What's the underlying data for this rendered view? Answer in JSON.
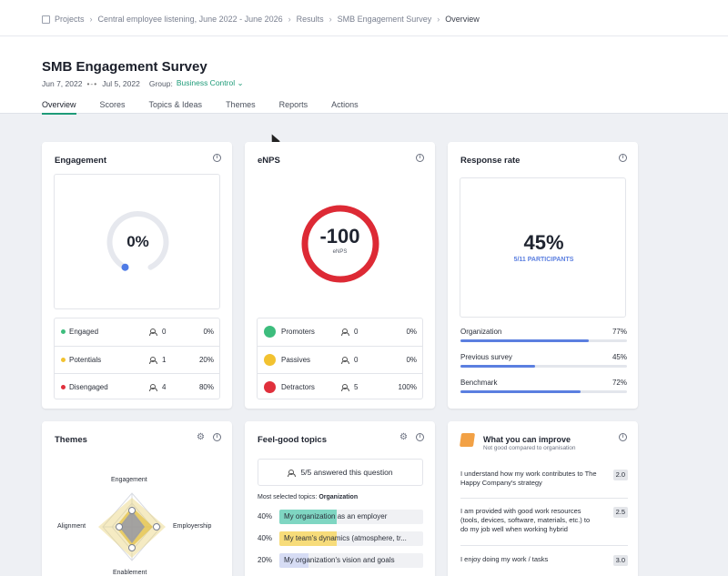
{
  "breadcrumb": [
    "Projects",
    "Central employee listening, June 2022 - June 2026",
    "Results",
    "SMB Engagement Survey",
    "Overview"
  ],
  "header": {
    "title": "SMB Engagement Survey",
    "date_start": "Jun 7, 2022",
    "date_end": "Jul 5, 2022",
    "group_label": "Group:",
    "group_value": "Business Control"
  },
  "tabs": [
    "Overview",
    "Scores",
    "Topics & Ideas",
    "Themes",
    "Reports",
    "Actions"
  ],
  "engagement": {
    "title": "Engagement",
    "value": "0%",
    "gauge_fraction": 0.0,
    "rows": [
      {
        "label": "Engaged",
        "count": "0",
        "pct": "0%",
        "color": "#3dbd7d"
      },
      {
        "label": "Potentials",
        "count": "1",
        "pct": "20%",
        "color": "#f2c230"
      },
      {
        "label": "Disengaged",
        "count": "4",
        "pct": "80%",
        "color": "#e0303c"
      }
    ]
  },
  "enps": {
    "title": "eNPS",
    "value": "-100",
    "sub": "eNPS",
    "rows": [
      {
        "label": "Promoters",
        "count": "0",
        "pct": "0%",
        "color": "#3dbd7d"
      },
      {
        "label": "Passives",
        "count": "0",
        "pct": "0%",
        "color": "#f2c230"
      },
      {
        "label": "Detractors",
        "count": "5",
        "pct": "100%",
        "color": "#e0303c"
      }
    ]
  },
  "response": {
    "title": "Response rate",
    "value": "45%",
    "participants": "5/11 PARTICIPANTS",
    "bars": [
      {
        "label": "Organization",
        "value": "77%",
        "fraction": 0.77
      },
      {
        "label": "Previous survey",
        "value": "45%",
        "fraction": 0.45
      },
      {
        "label": "Benchmark",
        "value": "72%",
        "fraction": 0.72
      }
    ]
  },
  "themes": {
    "title": "Themes",
    "labels": [
      "Engagement",
      "Employership",
      "Enablement",
      "Alignment"
    ]
  },
  "feelgood": {
    "title": "Feel-good topics",
    "answered": "5/5 answered this question",
    "most_prefix": "Most selected topics:",
    "most_value": "Organization",
    "topics": [
      {
        "pct": "40%",
        "fraction": 0.4,
        "text": "My organization as an employer",
        "color": "#7fd6c2"
      },
      {
        "pct": "40%",
        "fraction": 0.4,
        "text": "My team's dynamics (atmosphere, tr...",
        "color": "#f7dc7a"
      },
      {
        "pct": "20%",
        "fraction": 0.2,
        "text": "My organization's vision and goals",
        "color": "#d6dcf4"
      }
    ]
  },
  "improve": {
    "title": "What you can improve",
    "subtitle": "Not good compared to organisation",
    "items": [
      {
        "text": "I understand how my work contributes to The Happy Company's strategy",
        "score": "2.0"
      },
      {
        "text": "I am provided with good work resources (tools, devices, software, materials, etc.) to do my job well when working hybrid",
        "score": "2.5"
      },
      {
        "text": "I enjoy doing my work / tasks",
        "score": "3.0"
      }
    ]
  }
}
